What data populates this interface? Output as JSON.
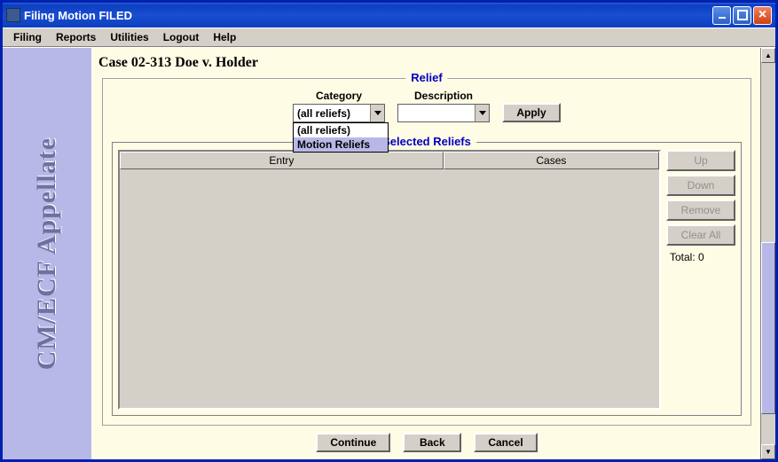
{
  "window": {
    "title": "Filing Motion FILED"
  },
  "menubar": {
    "items": [
      "Filing",
      "Reports",
      "Utilities",
      "Logout",
      "Help"
    ]
  },
  "sidebar": {
    "brand": "CM/ECF Appellate"
  },
  "case": {
    "title": "Case 02-313 Doe v. Holder"
  },
  "relief": {
    "legend": "Relief",
    "category_label": "Category",
    "description_label": "Description",
    "category_value": "(all reliefs)",
    "category_options": [
      {
        "label": "(all reliefs)",
        "selected": false
      },
      {
        "label": "Motion Reliefs",
        "selected": true
      }
    ],
    "description_value": "",
    "apply_label": "Apply"
  },
  "selected_reliefs": {
    "legend": "Selected Reliefs",
    "columns": {
      "entry": "Entry",
      "cases": "Cases"
    },
    "buttons": {
      "up": "Up",
      "down": "Down",
      "remove": "Remove",
      "clear_all": "Clear All"
    },
    "total_label": "Total: 0"
  },
  "footer": {
    "continue": "Continue",
    "back": "Back",
    "cancel": "Cancel"
  }
}
